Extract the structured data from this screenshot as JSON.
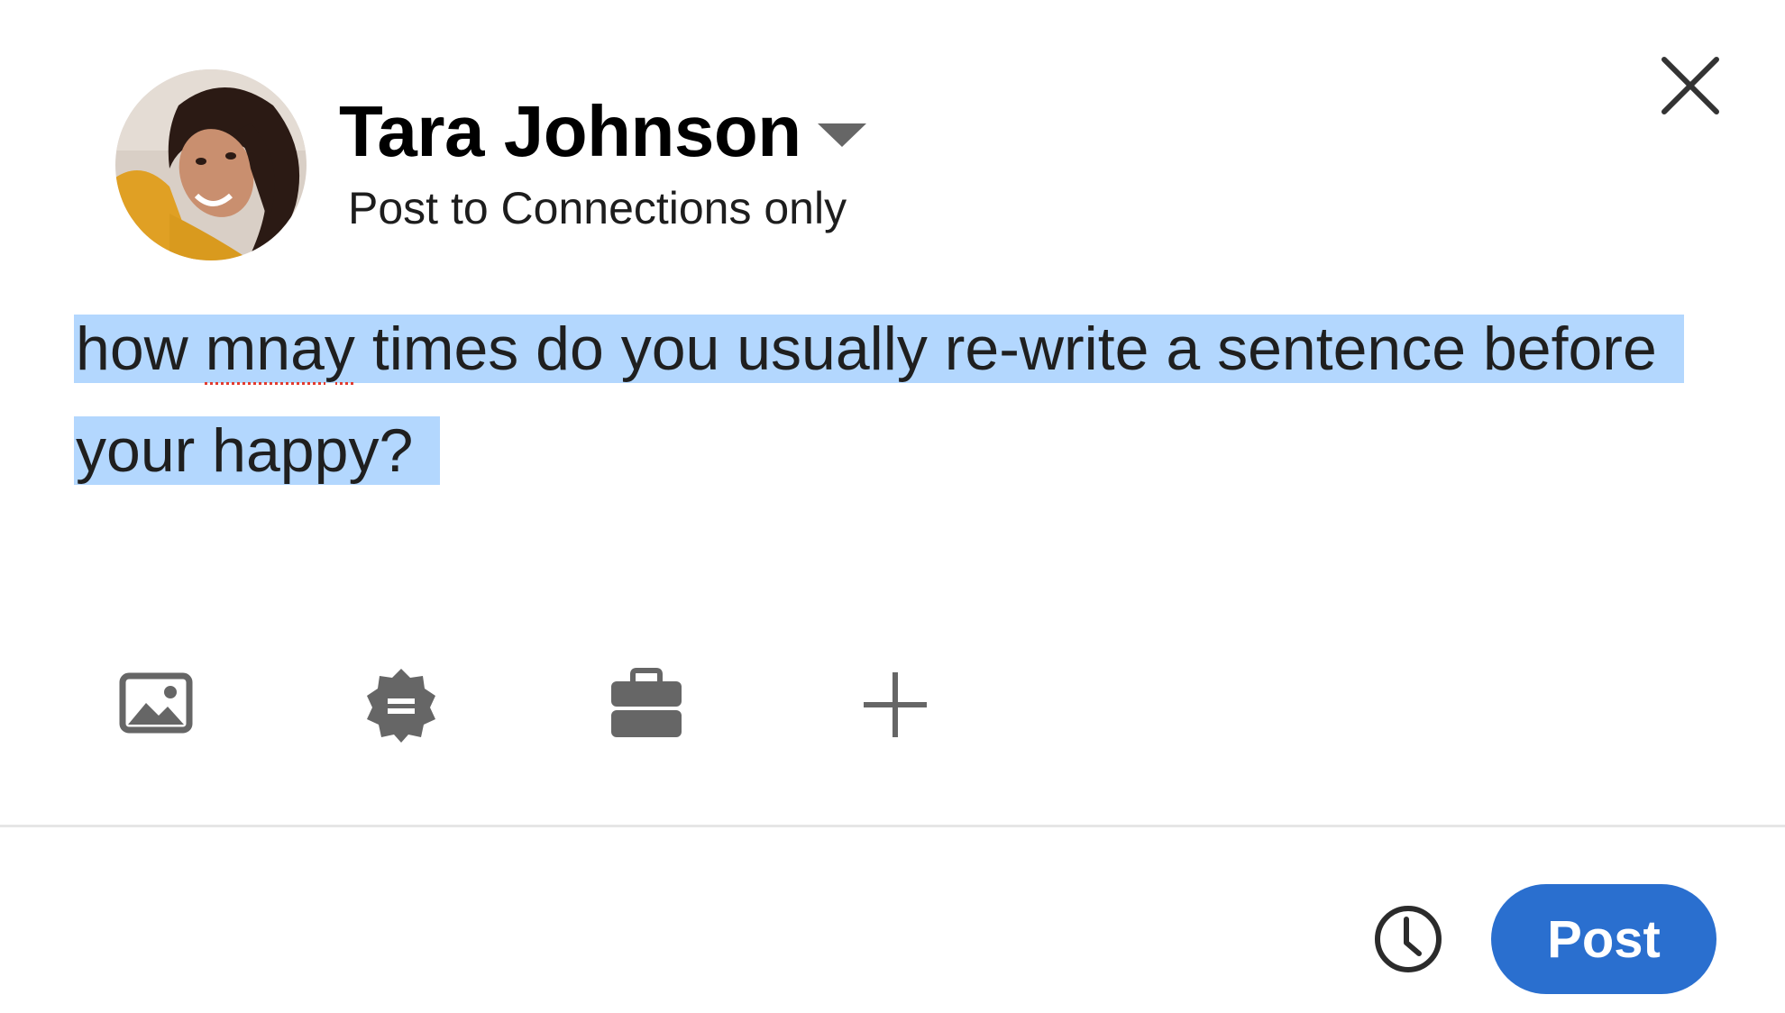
{
  "header": {
    "author_name": "Tara Johnson",
    "audience": "Post to Connections only"
  },
  "composer": {
    "segments": [
      "how ",
      "mnay",
      " times do you usually re-write a sentence before your happy?"
    ],
    "selection_color": "#b3d7fe",
    "misspelled_word": "mnay"
  },
  "toolbar": {
    "icons": [
      "photo-icon",
      "event-badge-icon",
      "job-briefcase-icon",
      "add-more-icon"
    ],
    "icon_color": "#666666"
  },
  "footer": {
    "post_label": "Post",
    "post_button_color": "#2a6fcf",
    "schedule_icon": "clock-icon"
  },
  "close_icon": "close-icon"
}
